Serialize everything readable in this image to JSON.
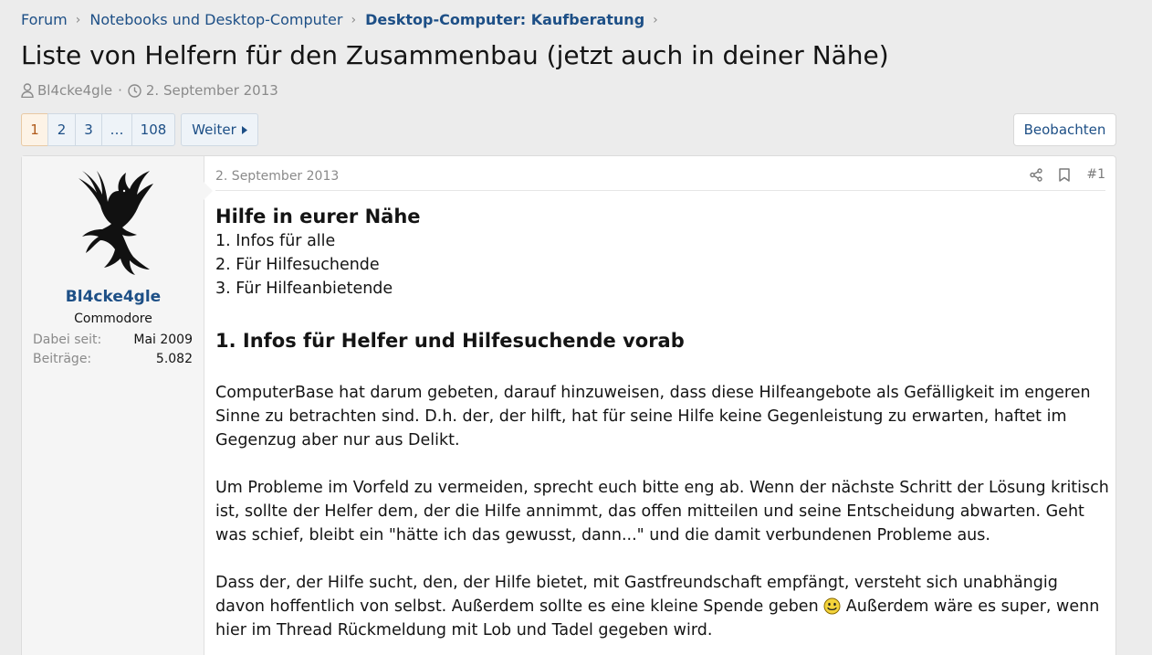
{
  "breadcrumb": {
    "items": [
      "Forum",
      "Notebooks und Desktop-Computer",
      "Desktop-Computer: Kaufberatung"
    ]
  },
  "thread": {
    "title": "Liste von Helfern für den Zusammenbau (jetzt auch in deiner Nähe)",
    "author": "Bl4cke4gle",
    "date": "2. September 2013"
  },
  "pagination": {
    "pages": [
      "1",
      "2",
      "3",
      "…",
      "108"
    ],
    "active": "1",
    "next_label": "Weiter"
  },
  "watch_label": "Beobachten",
  "post": {
    "user": {
      "name": "Bl4cke4gle",
      "title": "Commodore",
      "stats": [
        {
          "key": "Dabei seit:",
          "value": "Mai 2009"
        },
        {
          "key": "Beiträge:",
          "value": "5.082"
        }
      ]
    },
    "date": "2. September 2013",
    "number": "#1",
    "heading": "Hilfe in eurer Nähe",
    "toc": [
      "1. Infos für alle",
      "2. Für Hilfesuchende",
      "3. Für Hilfeanbietende"
    ],
    "section_heading": "1. Infos für Helfer und Hilfesuchende vorab",
    "paragraphs": [
      "ComputerBase hat darum gebeten, darauf hinzuweisen, dass diese Hilfeangebote als Gefälligkeit im engeren Sinne zu betrachten sind. D.h. der, der hilft, hat für seine Hilfe keine Gegenleistung zu erwarten, haftet im Gegenzug aber nur aus Delikt.",
      "Um Probleme im Vorfeld zu vermeiden, sprecht euch bitte eng ab. Wenn der nächste Schritt der Lösung kritisch ist, sollte der Helfer dem, der die Hilfe annimmt, das offen mitteilen und seine Entscheidung abwarten. Geht was schief, bleibt ein \"hätte ich das gewusst, dann...\" und die damit verbundenen Probleme aus."
    ],
    "last_paragraph_before": "Dass der, der Hilfe sucht, den, der Hilfe bietet, mit Gastfreundschaft empfängt, versteht sich unabhängig davon hoffentlich von selbst. Außerdem sollte es eine kleine Spende geben ",
    "last_paragraph_after": " Außerdem wäre es super, wenn hier im Thread Rückmeldung mit Lob und Tadel gegeben wird."
  }
}
